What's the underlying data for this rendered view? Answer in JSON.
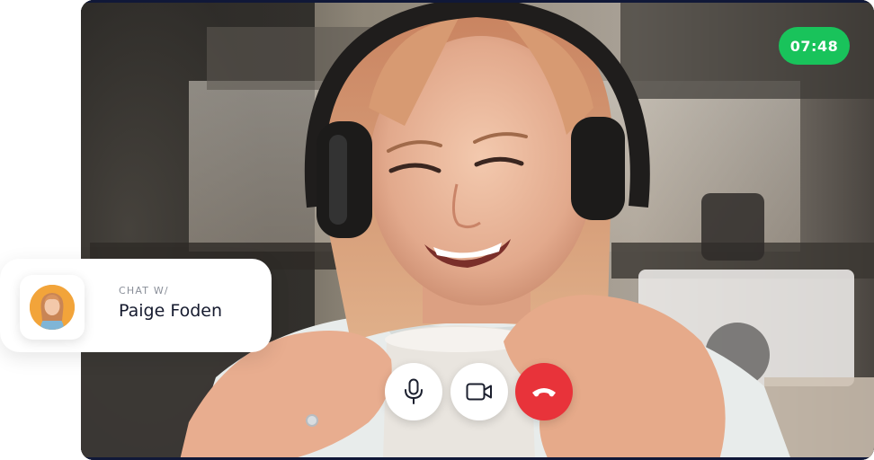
{
  "call": {
    "timer": "07:48"
  },
  "chat": {
    "caption": "CHAT W/",
    "contact_name": "Paige Foden"
  },
  "controls": {
    "microphone_icon": "microphone-icon",
    "camera_icon": "video-camera-icon",
    "hangup_icon": "phone-hangup-icon"
  },
  "colors": {
    "timer_bg": "#19c35b",
    "end_call": "#e8333a",
    "frame_border": "#101838"
  }
}
